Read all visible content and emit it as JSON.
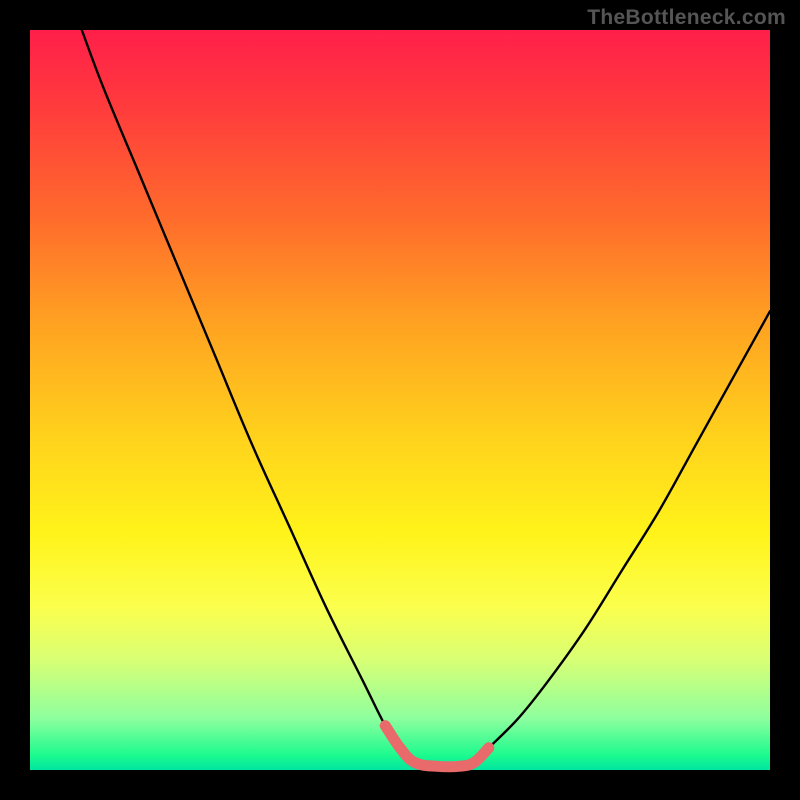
{
  "watermark": "TheBottleneck.com",
  "colors": {
    "frame": "#000000",
    "curve": "#000000",
    "highlight": "#e86a6a",
    "gradient_stops": [
      "#ff1f4a",
      "#ff3a3d",
      "#ff6a2c",
      "#ffa321",
      "#ffd21c",
      "#fff31a",
      "#fbff4d",
      "#d9ff74",
      "#8eff9e",
      "#1dfb8e",
      "#00e5a0"
    ]
  },
  "chart_data": {
    "type": "line",
    "title": "",
    "xlabel": "",
    "ylabel": "",
    "xlim": [
      0,
      100
    ],
    "ylim": [
      0,
      100
    ],
    "note": "x and y are in percent of the gradient plot area; y=0 at top (red), y=100 at bottom (green). Curve values estimated from pixels.",
    "series": [
      {
        "name": "bottleneck-curve",
        "x": [
          7,
          10,
          15,
          20,
          25,
          30,
          35,
          40,
          45,
          48,
          50,
          52,
          55,
          58,
          60,
          62,
          66,
          70,
          75,
          80,
          85,
          90,
          95,
          100
        ],
        "y": [
          0,
          8,
          20,
          32,
          44,
          56,
          67,
          78,
          88,
          94,
          97,
          99,
          99.5,
          99.5,
          99,
          97,
          93,
          88,
          81,
          73,
          65,
          56,
          47,
          38
        ]
      }
    ],
    "highlight_segment": {
      "name": "optimal-range",
      "x": [
        48,
        50,
        52,
        55,
        58,
        60,
        62
      ],
      "y": [
        94,
        97,
        99,
        99.5,
        99.5,
        99,
        97
      ]
    }
  }
}
